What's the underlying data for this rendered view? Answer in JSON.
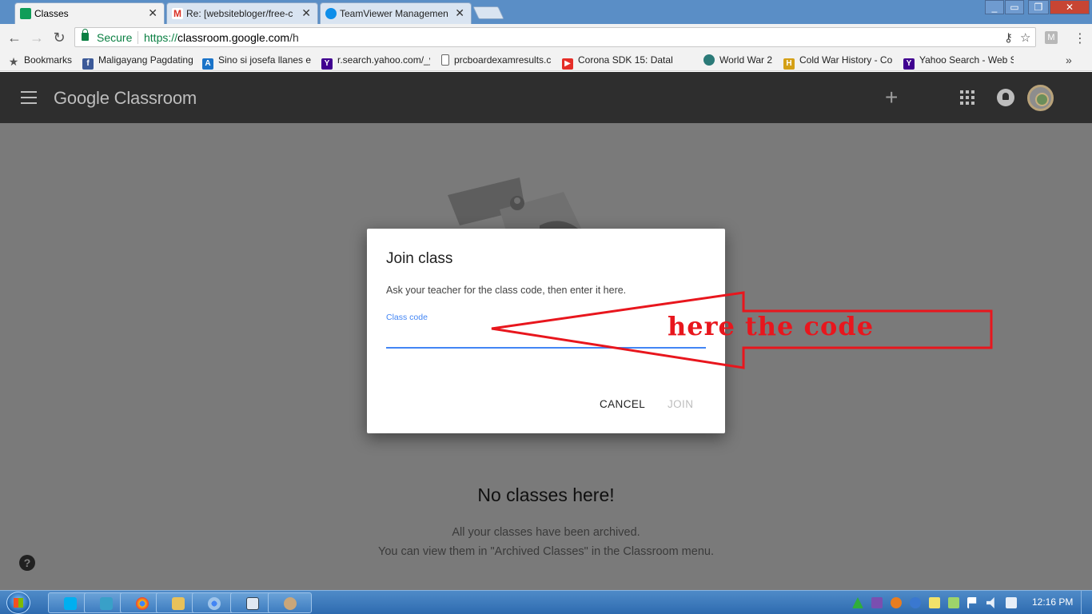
{
  "browser": {
    "tabs": [
      {
        "title": "Classes",
        "active": true,
        "icon": "classroom-icon",
        "color": "#0f9d58"
      },
      {
        "title": "Re: [websitebloger/free-c",
        "active": false,
        "icon": "gmail-icon",
        "color": "#d93025"
      },
      {
        "title": "TeamViewer Management",
        "active": false,
        "icon": "teamviewer-icon",
        "color": "#0e8ee9"
      }
    ],
    "secure_label": "Secure",
    "url_scheme": "https://",
    "url_host": "classroom.google.com",
    "url_path": "/h",
    "extension_label": "M"
  },
  "bookmarks": [
    {
      "label": "Bookmarks",
      "icon": "star-icon"
    },
    {
      "label": "Maligayang Pagdating",
      "icon": "facebook-icon",
      "color": "#3b5998"
    },
    {
      "label": "Sino si josefa llanes es",
      "icon": "ask-icon",
      "color": "#1a73c8"
    },
    {
      "label": "r.search.yahoo.com/_y",
      "icon": "yahoo-icon",
      "color": "#400090"
    },
    {
      "label": "prcboardexamresults.c",
      "icon": "page-icon",
      "color": "#ffffff"
    },
    {
      "label": "Corona SDK 15: Datab",
      "icon": "youtube-icon",
      "color": "#e52d27"
    },
    {
      "label": "World War 2",
      "icon": "globe-icon",
      "color": "#2b7a78"
    },
    {
      "label": "Cold War History - Co",
      "icon": "history-icon",
      "color": "#d4a017"
    },
    {
      "label": "Yahoo Search - Web S",
      "icon": "yahoo-icon",
      "color": "#400090"
    }
  ],
  "app": {
    "brand": "Google Classroom"
  },
  "empty_state": {
    "title": "No classes here!",
    "line1": "All your classes have been archived.",
    "line2": "You can view them in \"Archived Classes\" in the Classroom menu."
  },
  "dialog": {
    "title": "Join class",
    "instruction": "Ask your teacher for the class code, then enter it here.",
    "field_label": "Class code",
    "field_value": "",
    "cancel_label": "CANCEL",
    "join_label": "JOIN"
  },
  "annotation": {
    "text": "here the code",
    "color": "#e8161d"
  },
  "taskbar": {
    "clock": "12:16 PM",
    "pinned": [
      "skype-icon",
      "vpn-icon",
      "chrome-icon",
      "explorer-icon",
      "chrome-icon",
      "window-icon",
      "paint-icon"
    ]
  },
  "colors": {
    "accent": "#4285f4",
    "appbar": "#2e2e2e"
  }
}
